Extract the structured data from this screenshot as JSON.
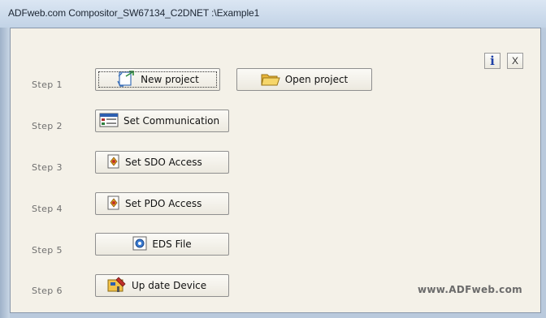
{
  "window": {
    "title": "ADFweb.com Compositor_SW67134_C2DNET :\\Example1"
  },
  "steps": [
    {
      "label": "Step 1"
    },
    {
      "label": "Step 2"
    },
    {
      "label": "Step 3"
    },
    {
      "label": "Step 4"
    },
    {
      "label": "Step 5"
    },
    {
      "label": "Step 6"
    }
  ],
  "buttons": {
    "new_project": "New project",
    "open_project": "Open project",
    "set_communication": "Set Communication",
    "set_sdo_access": "Set SDO Access",
    "set_pdo_access": "Set PDO Access",
    "eds_file": "EDS File",
    "update_device": "Up date Device"
  },
  "top_right": {
    "info_glyph": "i",
    "close_glyph": "X"
  },
  "footer": {
    "brand": "www.ADFweb.com"
  },
  "colors": {
    "accent_blue": "#1d3fa6",
    "client_bg": "#f4f1e8"
  }
}
